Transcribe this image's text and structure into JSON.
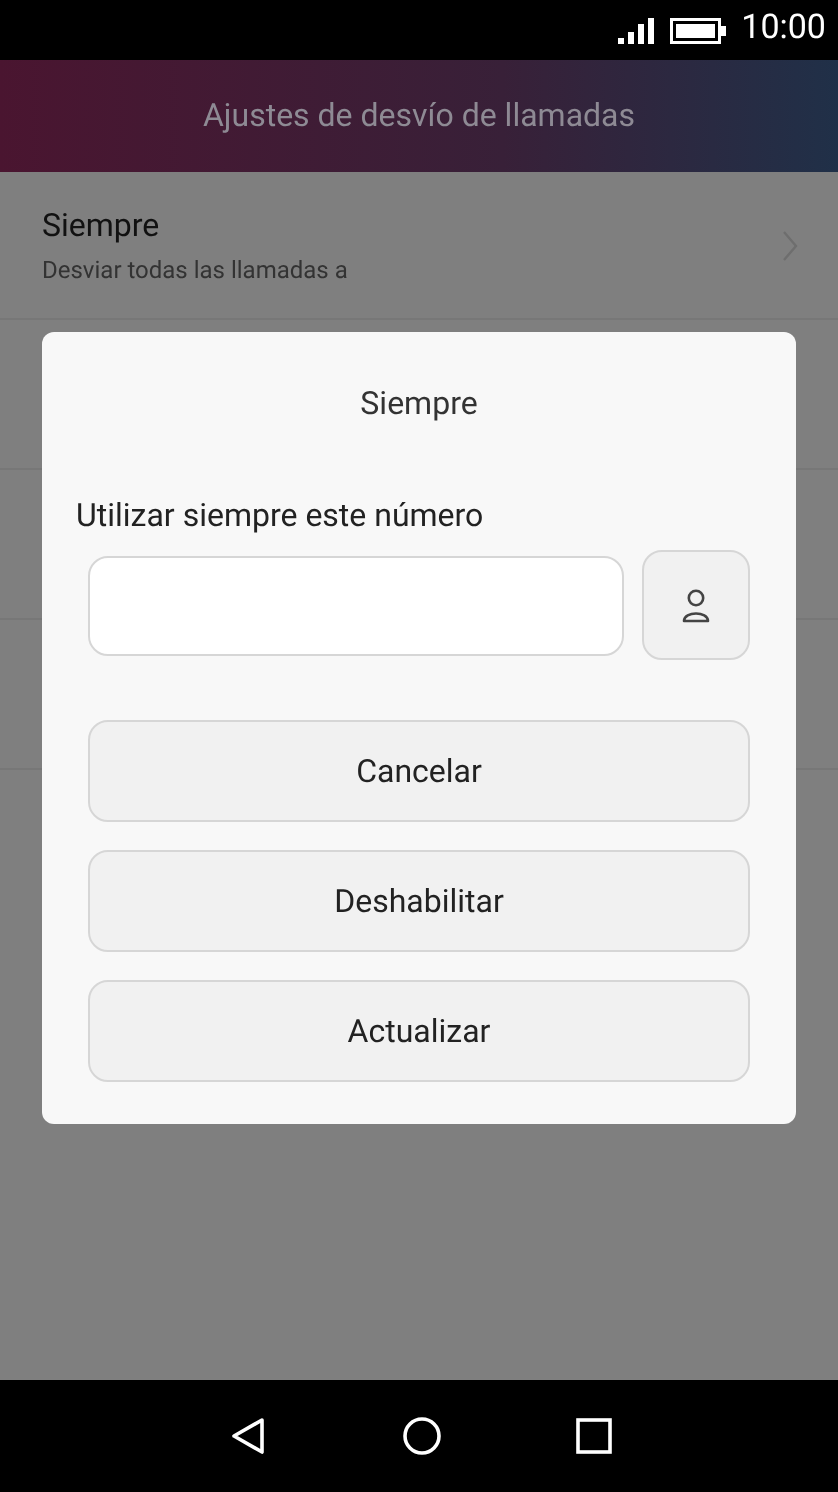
{
  "status_bar": {
    "time": "10:00"
  },
  "header": {
    "title": "Ajustes de desvío de llamadas"
  },
  "list": [
    {
      "title": "Siempre",
      "subtitle": "Desviar todas las llamadas a"
    }
  ],
  "dialog": {
    "title": "Siempre",
    "field_label": "Utilizar siempre este número",
    "buttons": [
      "Cancelar",
      "Deshabilitar",
      "Actualizar"
    ]
  }
}
